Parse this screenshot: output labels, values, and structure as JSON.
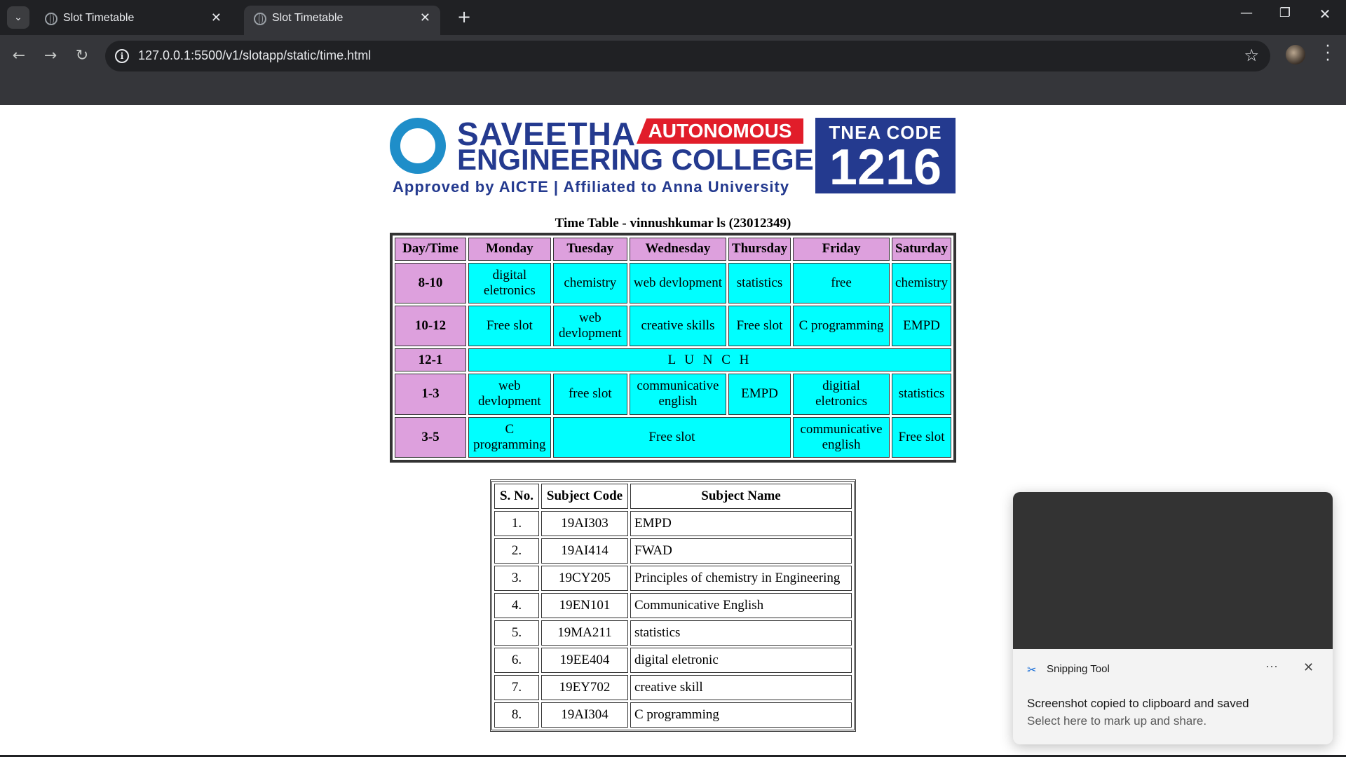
{
  "browser": {
    "tabs": [
      {
        "title": "Slot Timetable",
        "active": false
      },
      {
        "title": "Slot Timetable",
        "active": true
      }
    ],
    "url": "127.0.0.1:5500/v1/slotapp/static/time.html"
  },
  "logo": {
    "line1": "SAVEETHA",
    "line2": "ENGINEERING COLLEGE",
    "badge": "AUTONOMOUS",
    "tagline": "Approved by AICTE  |  Affiliated to Anna University",
    "tnea_label": "TNEA CODE",
    "tnea_code": "1216",
    "seal_text": "SAVEETHA"
  },
  "timetable": {
    "caption": "Time Table - vinnushkumar ls (23012349)",
    "headers": [
      "Day/Time",
      "Monday",
      "Tuesday",
      "Wednesday",
      "Thursday",
      "Friday",
      "Saturday"
    ],
    "rows": [
      {
        "slot": "8-10",
        "cells": [
          "digital eletronics",
          "chemistry",
          "web devlopment",
          "statistics",
          "free",
          "chemistry"
        ]
      },
      {
        "slot": "10-12",
        "cells": [
          "Free slot",
          "web devlopment",
          "creative skills",
          "Free slot",
          "C programming",
          "EMPD"
        ]
      },
      {
        "slot": "12-1",
        "lunch": "L U N C H"
      },
      {
        "slot": "1-3",
        "cells": [
          "web devlopment",
          "free slot",
          "communicative english",
          "EMPD",
          "digitial eletronics",
          "statistics"
        ]
      },
      {
        "slot": "3-5",
        "cells": [
          "C programming",
          "Free slot",
          "communicative english",
          "Free slot"
        ]
      }
    ]
  },
  "subjects": {
    "headers": [
      "S. No.",
      "Subject Code",
      "Subject Name"
    ],
    "rows": [
      {
        "sno": "1.",
        "code": "19AI303",
        "name": "EMPD"
      },
      {
        "sno": "2.",
        "code": "19AI414",
        "name": "FWAD"
      },
      {
        "sno": "3.",
        "code": "19CY205",
        "name": "Principles of chemistry in Engineering"
      },
      {
        "sno": "4.",
        "code": "19EN101",
        "name": "Communicative English"
      },
      {
        "sno": "5.",
        "code": "19MA211",
        "name": "statistics"
      },
      {
        "sno": "6.",
        "code": "19EE404",
        "name": "digital eletronic"
      },
      {
        "sno": "7.",
        "code": "19EY702",
        "name": "creative skill"
      },
      {
        "sno": "8.",
        "code": "19AI304",
        "name": "C programming"
      }
    ]
  },
  "notification": {
    "app": "Snipping Tool",
    "message": "Screenshot copied to clipboard and saved",
    "sub": "Select here to mark up and share."
  }
}
